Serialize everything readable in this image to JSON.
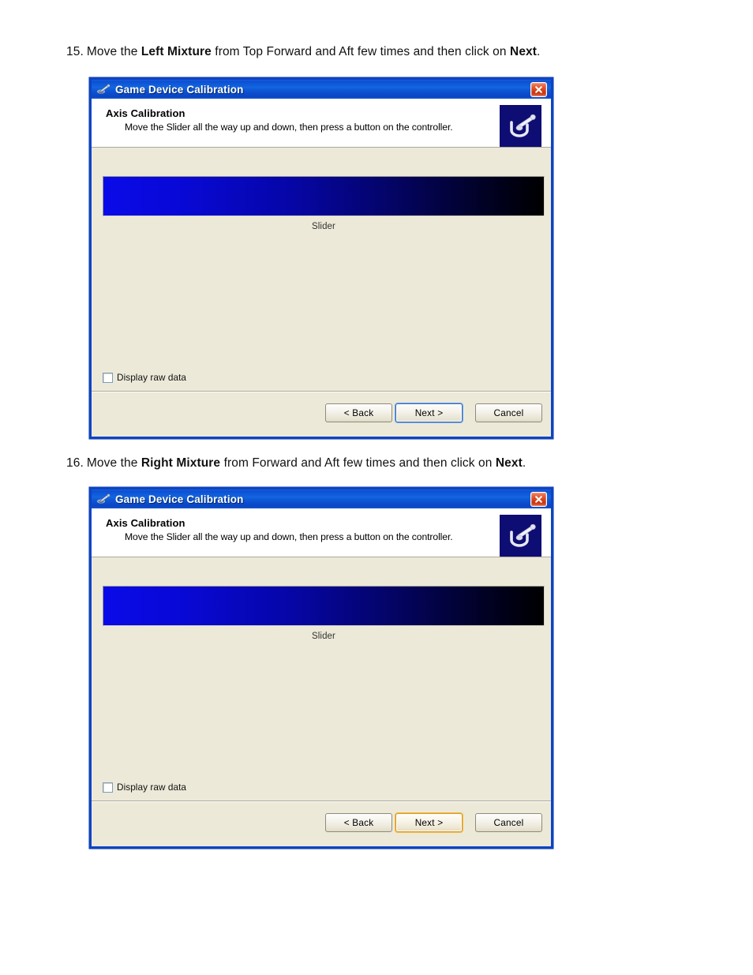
{
  "document": {
    "steps": [
      {
        "number": "15.",
        "text_before_bold": "Move the ",
        "bold_term": "Left Mixture",
        "text_middle": " from Top Forward and Aft few times and then click on ",
        "bold_action": "Next",
        "text_end": "."
      },
      {
        "number": "16.",
        "text_before_bold": "Move the ",
        "bold_term": "Right Mixture",
        "text_middle": " from Forward and Aft few times and then click on ",
        "bold_action": "Next",
        "text_end": "."
      }
    ]
  },
  "dialogs": [
    {
      "titlebar": {
        "title": "Game Device Calibration",
        "icon": "joystick-icon",
        "close_label": "×"
      },
      "header": {
        "heading": "Axis Calibration",
        "description": "Move the Slider all the way up and down, then press a button on the controller.",
        "icon": "joystick-illustration-icon"
      },
      "body": {
        "axis_label": "Slider",
        "checkbox": {
          "label": "Display raw data",
          "checked": false
        }
      },
      "footer": {
        "back_label": "< Back",
        "next_label": "Next >",
        "cancel_label": "Cancel",
        "next_state": "focused"
      }
    },
    {
      "titlebar": {
        "title": "Game Device Calibration",
        "icon": "joystick-icon",
        "close_label": "×"
      },
      "header": {
        "heading": "Axis Calibration",
        "description": "Move the Slider all the way up and down, then press a button on the controller.",
        "icon": "joystick-illustration-icon"
      },
      "body": {
        "axis_label": "Slider",
        "checkbox": {
          "label": "Display raw data",
          "checked": false
        }
      },
      "footer": {
        "back_label": "< Back",
        "next_label": "Next >",
        "cancel_label": "Cancel",
        "next_state": "hovered"
      }
    }
  ],
  "colors": {
    "titlebar_blue": "#0b44c4",
    "window_frame": "#0b44c4",
    "dialog_body": "#ece9d8",
    "header_band": "#ffffff",
    "axis_gradient_start": "#0a0ae8",
    "axis_gradient_end": "#000000",
    "header_icon_bg": "#0d0d73",
    "close_red": "#c8340f",
    "focus_ring_blue": "#6f9ede",
    "hover_ring_orange": "#d99a22"
  }
}
